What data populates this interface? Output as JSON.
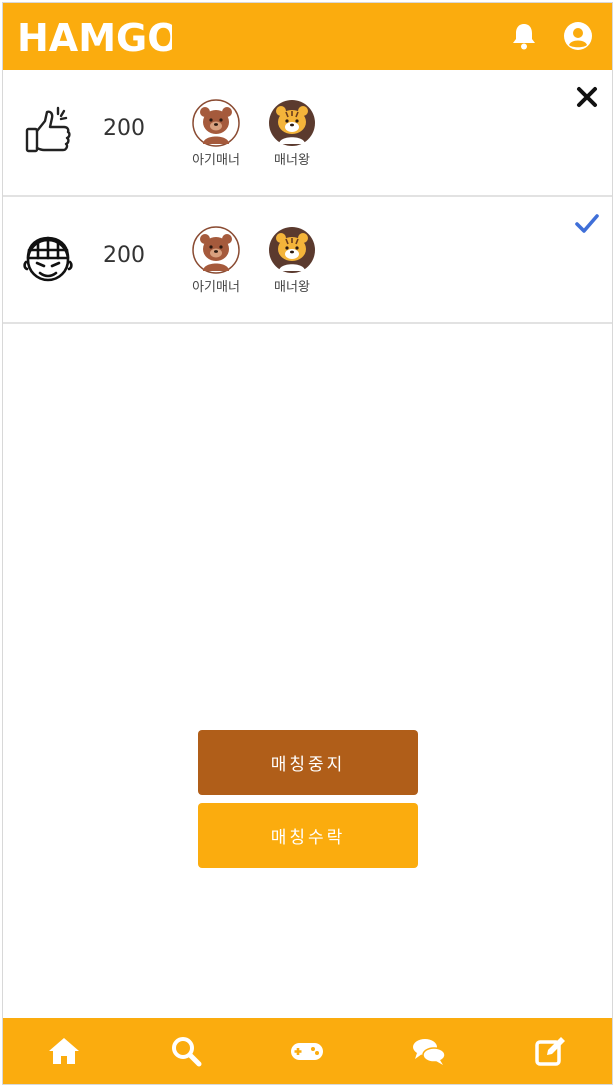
{
  "header": {
    "logo_text": "HAMGO",
    "icons": [
      "bell-icon",
      "user-circle-icon"
    ]
  },
  "colors": {
    "primary": "#fbac0e",
    "stop_button": "#b05e19",
    "check": "#3f6fd8",
    "divider": "#e2e2e2"
  },
  "matches": [
    {
      "icon": "thumbs-up-icon",
      "score": "200",
      "badges": [
        {
          "icon": "bear-avatar",
          "label": "아기매너"
        },
        {
          "icon": "tiger-avatar",
          "label": "매너왕"
        }
      ],
      "status_icon": "close-icon"
    },
    {
      "icon": "helmet-face-icon",
      "score": "200",
      "badges": [
        {
          "icon": "bear-avatar",
          "label": "아기매너"
        },
        {
          "icon": "tiger-avatar",
          "label": "매너왕"
        }
      ],
      "status_icon": "check-icon"
    }
  ],
  "actions": {
    "stop_label": "매칭중지",
    "accept_label": "매칭수락"
  },
  "bottom_nav": [
    "home-icon",
    "search-icon",
    "gamepad-icon",
    "chat-icon",
    "edit-icon"
  ]
}
